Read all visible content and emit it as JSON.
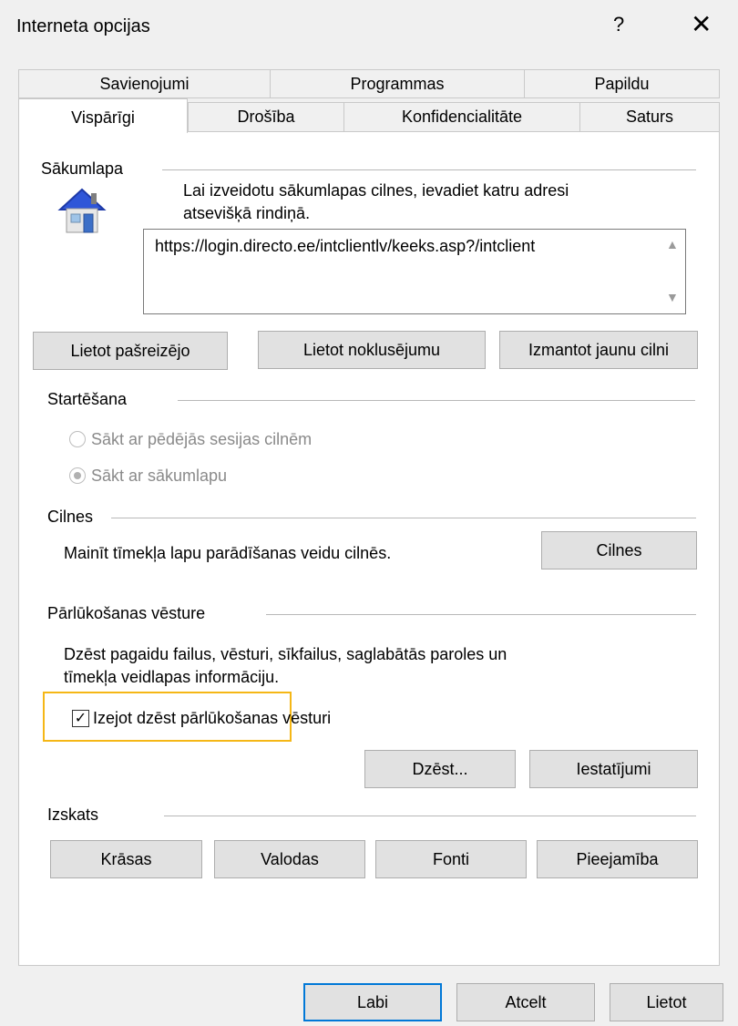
{
  "window": {
    "title": "Interneta opcijas",
    "help_glyph": "?",
    "close_glyph": "✕"
  },
  "tabs": {
    "row1": [
      "Savienojumi",
      "Programmas",
      "Papildu"
    ],
    "row2": [
      "Vispārīgi",
      "Drošība",
      "Konfidencialitāte",
      "Saturs"
    ],
    "active": "Vispārīgi"
  },
  "homepage": {
    "label": "Sākumlapa",
    "instructions_line1": "Lai izveidotu sākumlapas cilnes, ievadiet katru adresi",
    "instructions_line2": "atsevišķā rindiņā.",
    "url": "https://login.directo.ee/intclientlv/keeks.asp?/intclient",
    "buttons": [
      "Lietot pašreizējo",
      "Lietot noklusējumu",
      "Izmantot jaunu cilni"
    ]
  },
  "startup": {
    "label": "Startēšana",
    "options": [
      "Sākt ar pēdējās sesijas cilnēm",
      "Sākt ar sākumlapu"
    ],
    "selected_index": 1
  },
  "tabs_section": {
    "label": "Cilnes",
    "description": "Mainīt tīmekļa lapu parādīšanas veidu cilnēs.",
    "button": "Cilnes"
  },
  "history": {
    "label": "Pārlūkošanas vēsture",
    "description_line1": "Dzēst pagaidu failus, vēsturi, sīkfailus, saglabātās paroles un",
    "description_line2": "tīmekļa veidlapas informāciju.",
    "checkbox_label": "Izejot dzēst pārlūkošanas vēsturi",
    "checkbox_checked": true,
    "buttons": [
      "Dzēst...",
      "Iestatījumi"
    ]
  },
  "appearance": {
    "label": "Izskats",
    "buttons": [
      "Krāsas",
      "Valodas",
      "Fonti",
      "Pieejamība"
    ]
  },
  "footer": {
    "buttons": [
      "Labi",
      "Atcelt",
      "Lietot"
    ]
  },
  "colors": {
    "accent": "#0078d7",
    "highlight": "#f5b716"
  }
}
